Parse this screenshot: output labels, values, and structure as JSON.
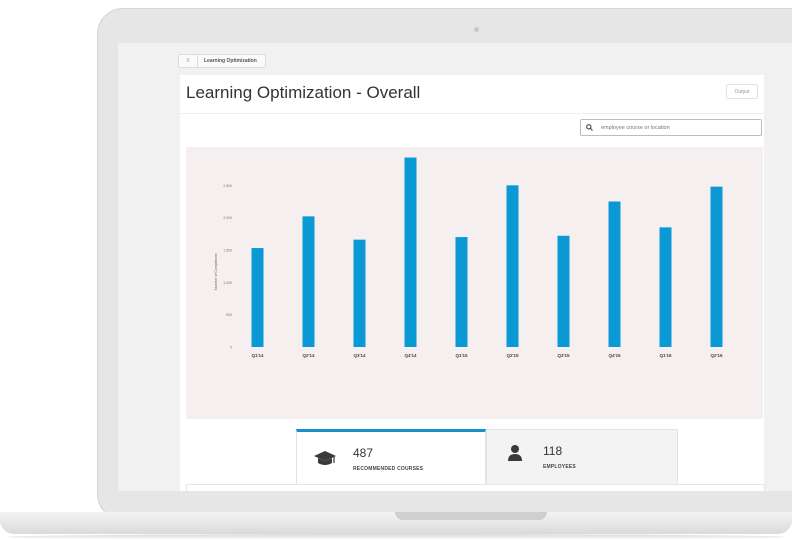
{
  "breadcrumb": {
    "items": [
      "Learning Optimization"
    ]
  },
  "page": {
    "title": "Learning Optimization - Overall",
    "output_label": "Output"
  },
  "search": {
    "placeholder": "employee course or location"
  },
  "chart_data": {
    "type": "bar",
    "categories": [
      "Q1'14",
      "Q2'14",
      "Q3'14",
      "Q4'14",
      "Q1'15",
      "Q2'15",
      "Q3'15",
      "Q4'15",
      "Q1'16",
      "Q2'16"
    ],
    "values": [
      1530,
      2020,
      1660,
      2930,
      1700,
      2500,
      1720,
      2250,
      1850,
      2480
    ],
    "ylabel": "Number of Completions",
    "yticks": [
      "0",
      "500",
      "1,000",
      "1,500",
      "2,000",
      "2,500"
    ],
    "ylim": [
      0,
      3000
    ],
    "bar_color": "#0b99d6",
    "background_color": "#f6efef"
  },
  "stats": [
    {
      "value": "487",
      "label": "RECOMMENDED COURSES",
      "icon": "graduation-cap-icon"
    },
    {
      "value": "118",
      "label": "EMPLOYEES",
      "icon": "user-icon"
    }
  ],
  "colors": {
    "accent": "#1a8fd0"
  }
}
